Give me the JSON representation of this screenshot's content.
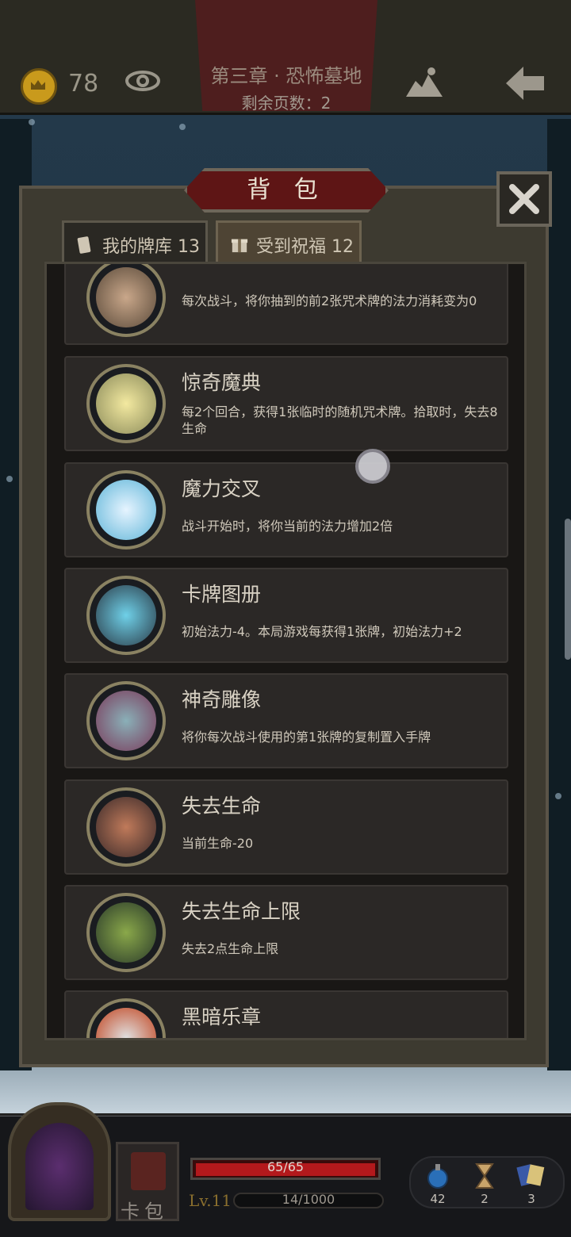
{
  "colors": {
    "accent_red": "#5e1515",
    "hp": "#b3191c",
    "panel": "#3d3a30",
    "card": "#2b2826"
  },
  "topbar": {
    "gold": "78",
    "chapter_title": "第三章 · 恐怖墓地",
    "pages_label": "剩余页数：2",
    "icons": [
      "coin-icon",
      "eye-icon",
      "map-icon",
      "back-arrow-icon"
    ]
  },
  "panel": {
    "title": "背 包",
    "close_icon": "close-icon",
    "tabs": [
      {
        "label": "我的牌库 13",
        "icon": "cards-icon",
        "active": false
      },
      {
        "label": "受到祝福 12",
        "icon": "gift-icon",
        "active": true
      }
    ]
  },
  "blessings": [
    {
      "name": "",
      "desc": "每次战斗，将你抽到的前2张咒术牌的法力消耗变为0",
      "icon": "hand-lightning-icon"
    },
    {
      "name": "惊奇魔典",
      "desc": "每2个回合，获得1张临时的随机咒术牌。拾取时，失去8生命",
      "icon": "magic-book-icon"
    },
    {
      "name": "魔力交叉",
      "desc": "战斗开始时，将你当前的法力增加2倍",
      "icon": "crossed-staffs-icon"
    },
    {
      "name": "卡牌图册",
      "desc": "初始法力-4。本局游戏每获得1张牌，初始法力+2",
      "icon": "card-album-icon"
    },
    {
      "name": "神奇雕像",
      "desc": "将你每次战斗使用的第1张牌的复制置入手牌",
      "icon": "gargoyle-statue-icon"
    },
    {
      "name": "失去生命",
      "desc": "当前生命-20",
      "icon": "bleeding-arm-icon"
    },
    {
      "name": "失去生命上限",
      "desc": "失去2点生命上限",
      "icon": "ghost-ogre-icon"
    },
    {
      "name": "黑暗乐章",
      "desc": "",
      "icon": "dark-music-icon"
    }
  ],
  "bottom": {
    "deck_label": "卡包",
    "hp_text": "65/65",
    "hp_fraction": 1.0,
    "level": "Lv.11",
    "xp_text": "14/1000",
    "xp_fraction": 0.014,
    "resources": [
      {
        "icon": "potion-icon",
        "value": "42"
      },
      {
        "icon": "hourglass-icon",
        "value": "2"
      },
      {
        "icon": "cards-stack-icon",
        "value": "3"
      }
    ]
  }
}
